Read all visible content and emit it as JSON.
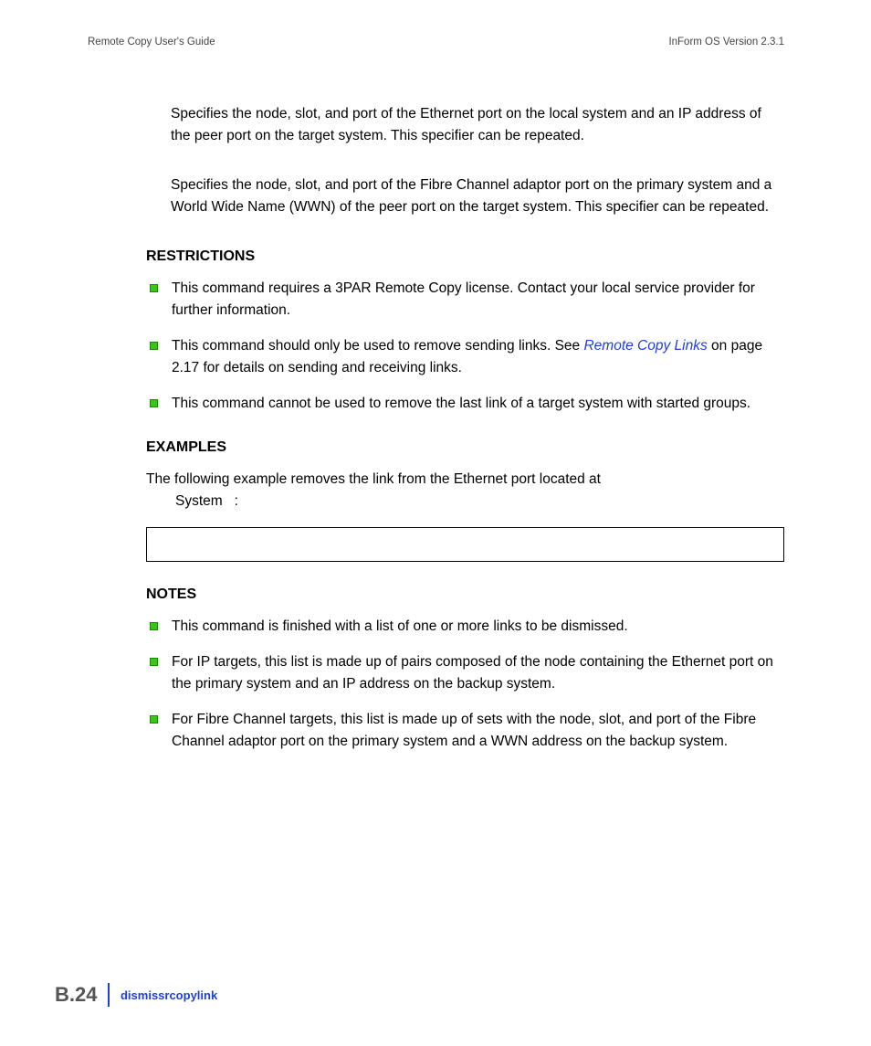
{
  "header": {
    "left": "Remote Copy User's Guide",
    "right": "InForm OS Version 2.3.1"
  },
  "paras": {
    "p1": "Specifies the node, slot, and port of the Ethernet port on the local system and an IP address of the peer port on the target system. This specifier can be repeated.",
    "p2": "Specifies the node, slot, and port of the Fibre Channel adaptor port on the primary system and a World Wide Name (WWN) of the peer port on the target system. This specifier can be repeated."
  },
  "sections": {
    "restrictions": {
      "title": "RESTRICTIONS",
      "items": {
        "r1": "This command requires a 3PAR Remote Copy license. Contact your local service provider for further information.",
        "r2a": "This command should only be used to remove sending links. See ",
        "r2link": "Remote Copy Links",
        "r2b": " on page 2.17 for details on sending and receiving links.",
        "r3": "This command cannot be used to remove the last link of a target system with started groups."
      }
    },
    "examples": {
      "title": "EXAMPLES",
      "line1": "The following example removes the link from the Ethernet port located at",
      "line2a": "System",
      "line2b": ":"
    },
    "notes": {
      "title": "NOTES",
      "items": {
        "n1": "This command is finished with a list of one or more links to be dismissed.",
        "n2": "For IP targets, this list is made up of pairs composed of the node containing the Ethernet port on the primary system and an IP address on the backup system.",
        "n3": "For Fibre Channel targets, this list is made up of sets with the node, slot, and port of the Fibre Channel adaptor port on the primary system and a WWN address on the backup system."
      }
    }
  },
  "footer": {
    "page": "B.24",
    "topic": "dismissrcopylink"
  }
}
